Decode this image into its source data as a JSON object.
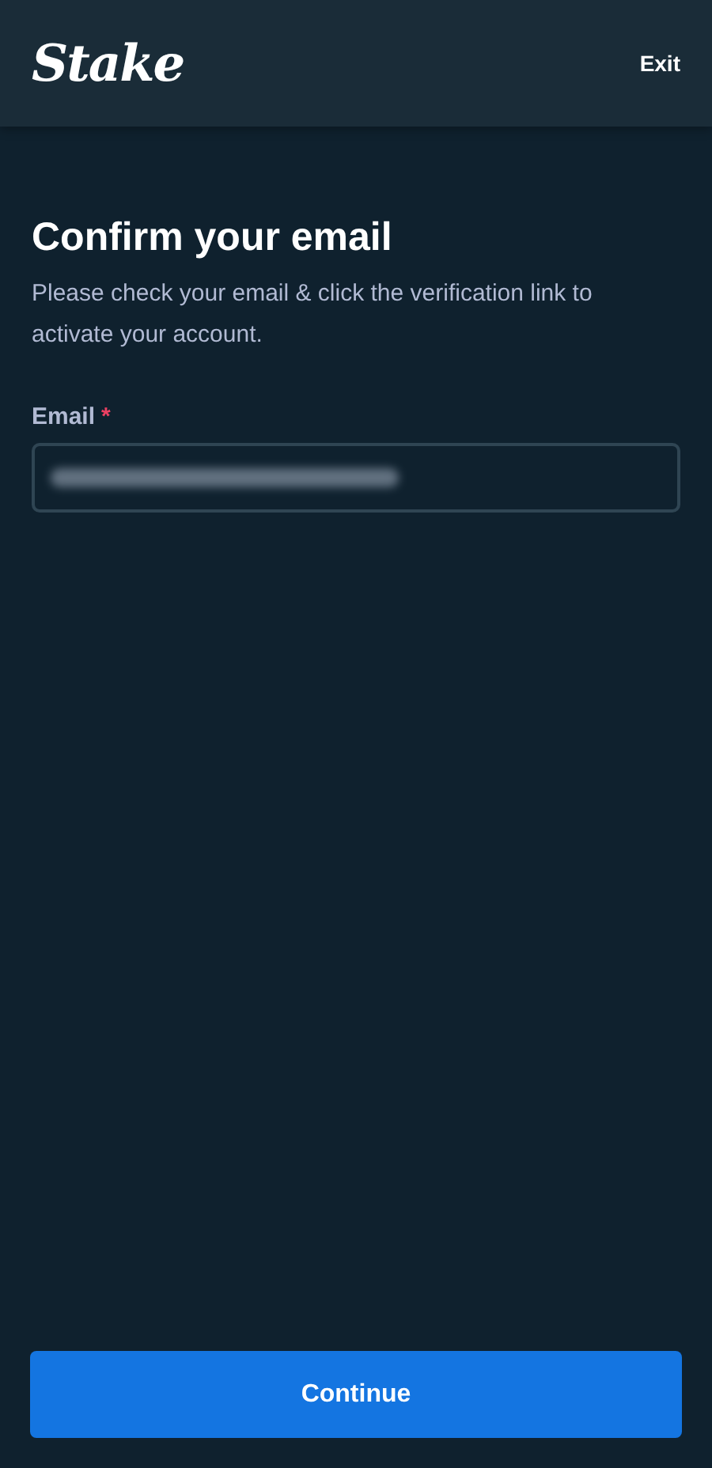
{
  "header": {
    "logo": "Stake",
    "exit": "Exit"
  },
  "title": "Confirm your email",
  "description": "Please check your email & click the verification link to activate your account.",
  "email_field": {
    "label": "Email",
    "required_mark": "*",
    "redacted": true
  },
  "continue_button": "Continue"
}
